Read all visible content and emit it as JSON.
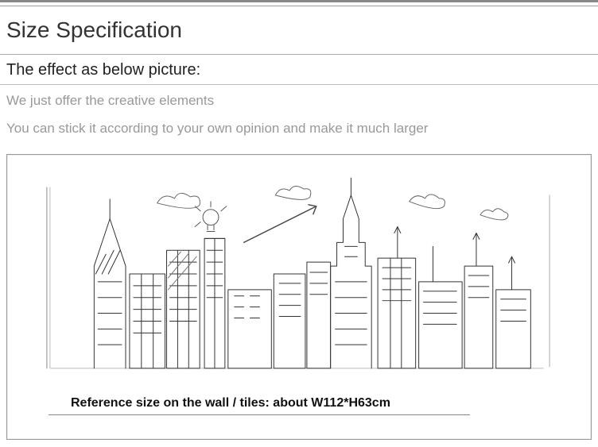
{
  "header": {
    "title": "Size Specification"
  },
  "subtitle": "The effect as below picture:",
  "descriptions": [
    "We just offer the creative elements",
    "You can stick it according to your own opinion and make it much larger"
  ],
  "panel": {
    "caption": "Reference size on the wall / tiles: about W112*H63cm",
    "illustration_name": "city-skyline-sketch"
  }
}
